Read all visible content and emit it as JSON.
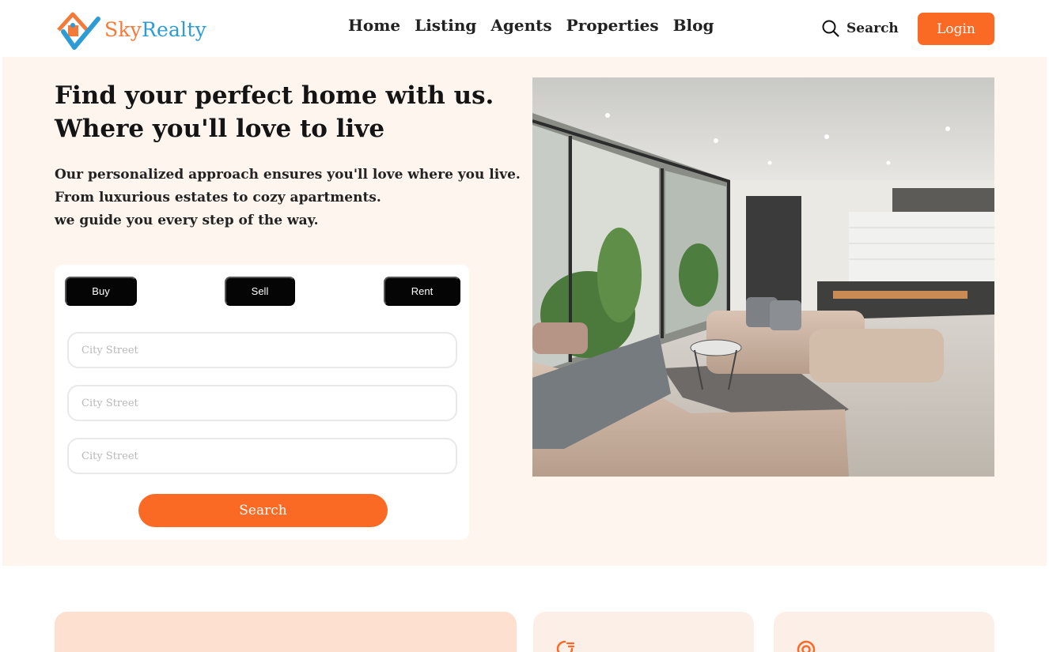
{
  "brand": {
    "name_part1": "Sky",
    "name_part2": "Realty",
    "accent": "#fb6a24",
    "secondary": "#2d9bd6"
  },
  "nav": {
    "items": [
      "Home",
      "Listing",
      "Agents",
      "Properties",
      "Blog"
    ]
  },
  "header": {
    "search_label": "Search",
    "login_label": "Login"
  },
  "hero": {
    "title_line1": "Find your perfect home with us.",
    "title_line2": "Where you'll love to live",
    "desc_line1": "Our personalized approach ensures you'll love where you live.",
    "desc_line2": "From luxurious estates to cozy apartments.",
    "desc_line3": "we guide you every step of the way."
  },
  "search_card": {
    "tabs": [
      "Buy",
      "Sell",
      "Rent"
    ],
    "fields": [
      {
        "placeholder": "City Street",
        "value": ""
      },
      {
        "placeholder": "City Street",
        "value": ""
      },
      {
        "placeholder": "City Street",
        "value": ""
      }
    ],
    "submit_label": "Search"
  },
  "features": {
    "card2_icon": "pie-chart-icon",
    "card3_icon": "target-icon"
  }
}
